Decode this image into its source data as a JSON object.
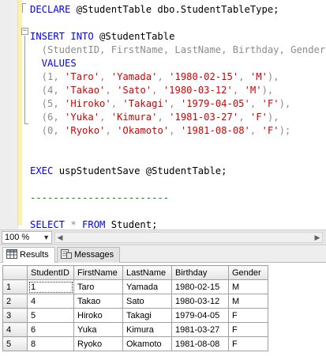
{
  "editor": {
    "lines": [
      [
        {
          "t": "DECLARE",
          "c": "kw"
        },
        {
          "t": " @StudentTable dbo.StudentTableType;",
          "c": "tx"
        }
      ],
      [],
      [
        {
          "t": "INSERT INTO",
          "c": "kw"
        },
        {
          "t": " @StudentTable",
          "c": "tx"
        }
      ],
      [
        {
          "t": "  (StudentID, FirstName, LastName, Birthday, Gender)",
          "c": "gr"
        }
      ],
      [
        {
          "t": "  VALUES",
          "c": "kw"
        }
      ],
      [
        {
          "t": "  (1, ",
          "c": "gr"
        },
        {
          "t": "'Taro'",
          "c": "st"
        },
        {
          "t": ", ",
          "c": "gr"
        },
        {
          "t": "'Yamada'",
          "c": "st"
        },
        {
          "t": ", ",
          "c": "gr"
        },
        {
          "t": "'1980-02-15'",
          "c": "st"
        },
        {
          "t": ", ",
          "c": "gr"
        },
        {
          "t": "'M'",
          "c": "st"
        },
        {
          "t": "),",
          "c": "gr"
        }
      ],
      [
        {
          "t": "  (4, ",
          "c": "gr"
        },
        {
          "t": "'Takao'",
          "c": "st"
        },
        {
          "t": ", ",
          "c": "gr"
        },
        {
          "t": "'Sato'",
          "c": "st"
        },
        {
          "t": ", ",
          "c": "gr"
        },
        {
          "t": "'1980-03-12'",
          "c": "st"
        },
        {
          "t": ", ",
          "c": "gr"
        },
        {
          "t": "'M'",
          "c": "st"
        },
        {
          "t": "),",
          "c": "gr"
        }
      ],
      [
        {
          "t": "  (5, ",
          "c": "gr"
        },
        {
          "t": "'Hiroko'",
          "c": "st"
        },
        {
          "t": ", ",
          "c": "gr"
        },
        {
          "t": "'Takagi'",
          "c": "st"
        },
        {
          "t": ", ",
          "c": "gr"
        },
        {
          "t": "'1979-04-05'",
          "c": "st"
        },
        {
          "t": ", ",
          "c": "gr"
        },
        {
          "t": "'F'",
          "c": "st"
        },
        {
          "t": "),",
          "c": "gr"
        }
      ],
      [
        {
          "t": "  (6, ",
          "c": "gr"
        },
        {
          "t": "'Yuka'",
          "c": "st"
        },
        {
          "t": ", ",
          "c": "gr"
        },
        {
          "t": "'Kimura'",
          "c": "st"
        },
        {
          "t": ", ",
          "c": "gr"
        },
        {
          "t": "'1981-03-27'",
          "c": "st"
        },
        {
          "t": ", ",
          "c": "gr"
        },
        {
          "t": "'F'",
          "c": "st"
        },
        {
          "t": "),",
          "c": "gr"
        }
      ],
      [
        {
          "t": "  (0, ",
          "c": "gr"
        },
        {
          "t": "'Ryoko'",
          "c": "st"
        },
        {
          "t": ", ",
          "c": "gr"
        },
        {
          "t": "'Okamoto'",
          "c": "st"
        },
        {
          "t": ", ",
          "c": "gr"
        },
        {
          "t": "'1981-08-08'",
          "c": "st"
        },
        {
          "t": ", ",
          "c": "gr"
        },
        {
          "t": "'F'",
          "c": "st"
        },
        {
          "t": ");",
          "c": "gr"
        }
      ],
      [],
      [],
      [
        {
          "t": "EXEC",
          "c": "kw"
        },
        {
          "t": " uspStudentSave @StudentTable;",
          "c": "tx"
        }
      ],
      [],
      [
        {
          "t": "------------------------",
          "c": "cm"
        }
      ],
      [],
      [
        {
          "t": "SELECT",
          "c": "kw"
        },
        {
          "t": " * ",
          "c": "gr"
        },
        {
          "t": "FROM",
          "c": "kw"
        },
        {
          "t": " Student;",
          "c": "tx"
        }
      ]
    ]
  },
  "zoom": {
    "value": "100 %"
  },
  "tabs": {
    "results": "Results",
    "messages": "Messages"
  },
  "grid": {
    "columns": [
      "StudentID",
      "FirstName",
      "LastName",
      "Birthday",
      "Gender"
    ],
    "rows": [
      {
        "num": "1",
        "cells": [
          "1",
          "Taro",
          "Yamada",
          "1980-02-15",
          "M"
        ]
      },
      {
        "num": "2",
        "cells": [
          "4",
          "Takao",
          "Sato",
          "1980-03-12",
          "M"
        ]
      },
      {
        "num": "3",
        "cells": [
          "5",
          "Hiroko",
          "Takagi",
          "1979-04-05",
          "F"
        ]
      },
      {
        "num": "4",
        "cells": [
          "6",
          "Yuka",
          "Kimura",
          "1981-03-27",
          "F"
        ]
      },
      {
        "num": "5",
        "cells": [
          "8",
          "Ryoko",
          "Okamoto",
          "1981-08-08",
          "F"
        ]
      }
    ]
  }
}
